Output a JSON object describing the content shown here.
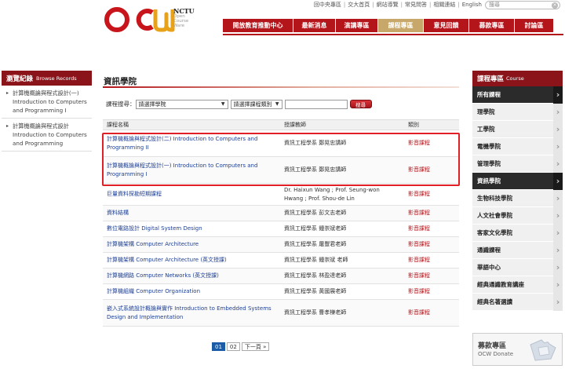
{
  "top_links": [
    "回中央專區",
    "交大首頁",
    "網站導覽",
    "常見問答",
    "相關連結",
    "English"
  ],
  "search": {
    "placeholder": "搜尋"
  },
  "logo": {
    "nctu": "NCTU",
    "sub": "Open Course Ware"
  },
  "nav": [
    {
      "label": "開放教育推動中心",
      "active": false,
      "w": 90
    },
    {
      "label": "最新消息",
      "active": false,
      "w": 54
    },
    {
      "label": "演講專區",
      "active": false,
      "w": 54
    },
    {
      "label": "課程專區",
      "active": true,
      "w": 58
    },
    {
      "label": "意見回饋",
      "active": false,
      "w": 58
    },
    {
      "label": "募款專區",
      "active": false,
      "w": 58
    },
    {
      "label": "討論區",
      "active": false,
      "w": 50
    }
  ],
  "browse": {
    "title": "瀏覽紀錄",
    "title_en": "Browse Records",
    "items": [
      "計算機概論與程式設計(一) Introduction to Computers and Programming I",
      "計算機概論與程式設計 Introduction to Computers and Programming"
    ]
  },
  "content": {
    "title": "資訊學院",
    "filter_label": "課程搜尋：",
    "college_select": "請選擇學院",
    "category_select": "請選擇課程類別",
    "search_button": "搜尋"
  },
  "table": {
    "headers": [
      "課程名稱",
      "授課教師",
      "類別"
    ],
    "rows": [
      {
        "name": "計算機概論與程式設計(二) Introduction to Computers and Programming II",
        "teacher": "資訊工程學系 鄭晃忠講師",
        "cat": "影音課程"
      },
      {
        "name": "計算機概論與程式設計(一) Introduction to Computers and Programming I",
        "teacher": "資訊工程學系 鄭晃忠講師",
        "cat": "影音課程"
      },
      {
        "name": "巨量資料探勘短期課程",
        "teacher": "Dr. Haixun Wang ; Prof. Seung-won Hwang ; Prof. Shou-de Lin",
        "cat": "影音課程"
      },
      {
        "name": "資料結構",
        "teacher": "資訊工程學系 彭文志老師",
        "cat": "影音課程"
      },
      {
        "name": "數位電路設計 Digital System Design",
        "teacher": "資訊工程學系 鍾崇斌老師",
        "cat": "影音課程"
      },
      {
        "name": "計算機架構 Computer Architecture",
        "teacher": "資訊工程學系 屠豐君老師",
        "cat": "影音課程"
      },
      {
        "name": "計算機架構 Computer Architecture (英文授課)",
        "teacher": "資訊工程學系 鍾崇斌 老師",
        "cat": "影音課程"
      },
      {
        "name": "計算機網路 Computer Networks (英文授課)",
        "teacher": "資訊工程學系 林盈達老師",
        "cat": "影音課程"
      },
      {
        "name": "計算機組織 Computer Organization",
        "teacher": "資訊工程學系 黃國展老師",
        "cat": "影音課程"
      },
      {
        "name": "嵌入式系統設計概論與實作 Introduction to Embedded Systems Design and Implementation",
        "teacher": "資訊工程學系 曹孝櫟老師",
        "cat": "影音課程"
      }
    ]
  },
  "pager": {
    "pages": [
      "01",
      "02"
    ],
    "next": "下一頁 »"
  },
  "course_zone": {
    "title": "課程專區",
    "title_en": "Course",
    "items": [
      {
        "label": "所有課程",
        "dark": true
      },
      {
        "label": "理學院",
        "dark": false
      },
      {
        "label": "工學院",
        "dark": false
      },
      {
        "label": "電機學院",
        "dark": false
      },
      {
        "label": "管理學院",
        "dark": false
      },
      {
        "label": "資訊學院",
        "dark": true
      },
      {
        "label": "生物科技學院",
        "dark": false
      },
      {
        "label": "人文社會學院",
        "dark": false
      },
      {
        "label": "客家文化學院",
        "dark": false
      },
      {
        "label": "通識課程",
        "dark": false
      },
      {
        "label": "華語中心",
        "dark": false
      },
      {
        "label": "經典通識教育講座",
        "dark": false
      },
      {
        "label": "經典名著選讀",
        "dark": false
      }
    ]
  },
  "donate": {
    "title": "募款專區",
    "subtitle": "OCW Donate"
  },
  "colors": {
    "primary": "#b3151b",
    "active_tab": "#c7a86a",
    "link": "#1d3f94",
    "highlight": "#e01f26"
  }
}
